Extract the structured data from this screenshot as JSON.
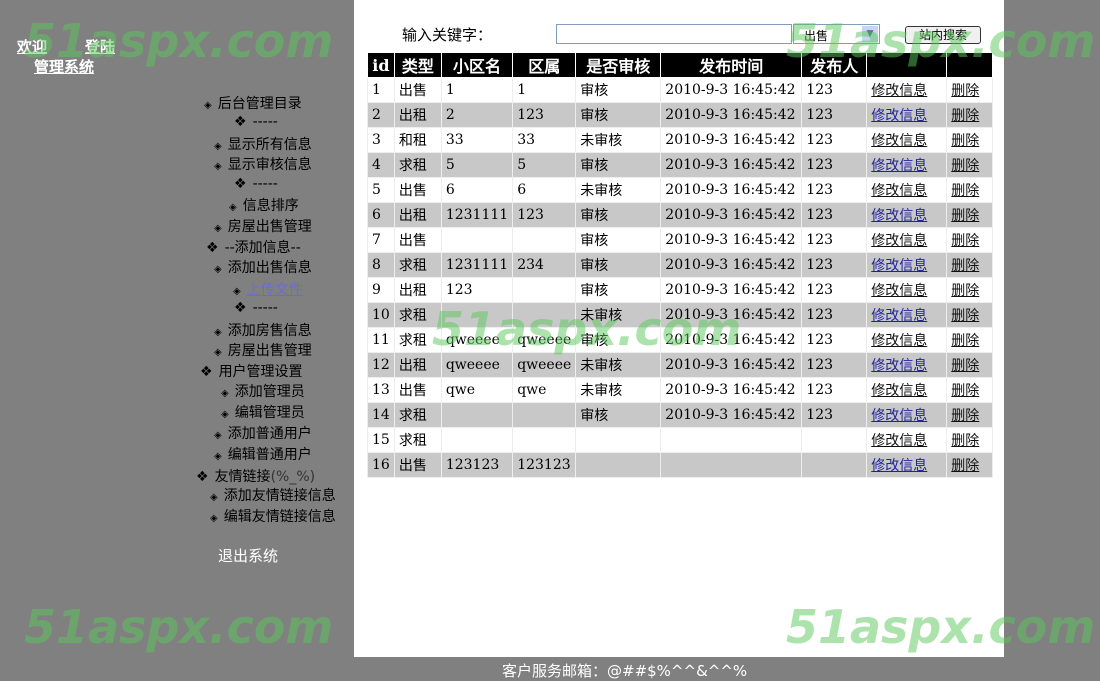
{
  "header": {
    "welcome": "欢迎",
    "login": "登陆",
    "system": "管理系统"
  },
  "nav": [
    {
      "icon": "diamond",
      "label": "后台管理目录"
    },
    {
      "icon": "four-dot",
      "label": "-----"
    },
    {
      "icon": "diamond",
      "label": "显示所有信息"
    },
    {
      "icon": "diamond",
      "label": "显示审核信息"
    },
    {
      "icon": "four-dot",
      "label": "-----"
    },
    {
      "icon": "diamond",
      "label": "信息排序"
    },
    {
      "icon": "diamond",
      "label": "房屋出售管理"
    },
    {
      "icon": "four-dot",
      "label": "--添加信息--"
    },
    {
      "icon": "diamond",
      "label": "添加出售信息"
    },
    {
      "icon": "diamond",
      "label": "上传文件"
    },
    {
      "icon": "four-dot",
      "label": "-----"
    },
    {
      "icon": "diamond",
      "label": "添加房售信息"
    },
    {
      "icon": "diamond",
      "label": "房屋出售管理"
    },
    {
      "icon": "four-dot",
      "label": "用户管理设置"
    },
    {
      "icon": "diamond",
      "label": "添加管理员"
    },
    {
      "icon": "diamond",
      "label": "编辑管理员"
    },
    {
      "icon": "diamond",
      "label": "添加普通用户"
    },
    {
      "icon": "diamond",
      "label": "编辑普通用户"
    },
    {
      "icon": "four-dot",
      "label": "友情链接",
      "note": "(%_%)"
    },
    {
      "icon": "diamond",
      "label": "添加友情链接信息"
    },
    {
      "icon": "diamond",
      "label": "编辑友情链接信息"
    }
  ],
  "logout": "退出系统",
  "search": {
    "label": "输入关键字：",
    "value": "",
    "type_selected": "出售",
    "button": "站内搜索"
  },
  "table": {
    "headers": [
      "id",
      "类型",
      "小区名",
      "区属",
      "是否审核",
      "发布时间",
      "发布人",
      "",
      ""
    ],
    "edit_label": "修改信息",
    "delete_label": "删除",
    "rows": [
      [
        "1",
        "出售",
        "1",
        "1",
        "审核",
        "2010-9-3 16:45:42",
        "123"
      ],
      [
        "2",
        "出租",
        "2",
        "123",
        "审核",
        "2010-9-3 16:45:42",
        "123"
      ],
      [
        "3",
        "和租",
        "33",
        "33",
        "未审核",
        "2010-9-3 16:45:42",
        "123"
      ],
      [
        "4",
        "求租",
        "5",
        "5",
        "审核",
        "2010-9-3 16:45:42",
        "123"
      ],
      [
        "5",
        "出售",
        "6",
        "6",
        "未审核",
        "2010-9-3 16:45:42",
        "123"
      ],
      [
        "6",
        "出租",
        "1231111",
        "123",
        "审核",
        "2010-9-3 16:45:42",
        "123"
      ],
      [
        "7",
        "出售",
        "",
        "",
        "审核",
        "2010-9-3 16:45:42",
        "123"
      ],
      [
        "8",
        "求租",
        "1231111",
        "234",
        "审核",
        "2010-9-3 16:45:42",
        "123"
      ],
      [
        "9",
        "出租",
        "123",
        "",
        "审核",
        "2010-9-3 16:45:42",
        "123"
      ],
      [
        "10",
        "求租",
        "",
        "",
        "未审核",
        "2010-9-3 16:45:42",
        "123"
      ],
      [
        "11",
        "求租",
        "qweeee",
        "qweeee",
        "审核",
        "2010-9-3 16:45:42",
        "123"
      ],
      [
        "12",
        "出租",
        "qweeee",
        "qweeee",
        "未审核",
        "2010-9-3 16:45:42",
        "123"
      ],
      [
        "13",
        "出售",
        "qwe",
        "qwe",
        "未审核",
        "2010-9-3 16:45:42",
        "123"
      ],
      [
        "14",
        "求租",
        "",
        "",
        "审核",
        "2010-9-3 16:45:42",
        "123"
      ],
      [
        "15",
        "求租",
        "",
        "",
        "",
        "",
        ""
      ],
      [
        "16",
        "出售",
        "123123",
        "123123",
        "",
        "",
        ""
      ]
    ]
  },
  "footer": "客户服务邮箱：@##$%^^&^^%",
  "watermark": "51aspx.com"
}
